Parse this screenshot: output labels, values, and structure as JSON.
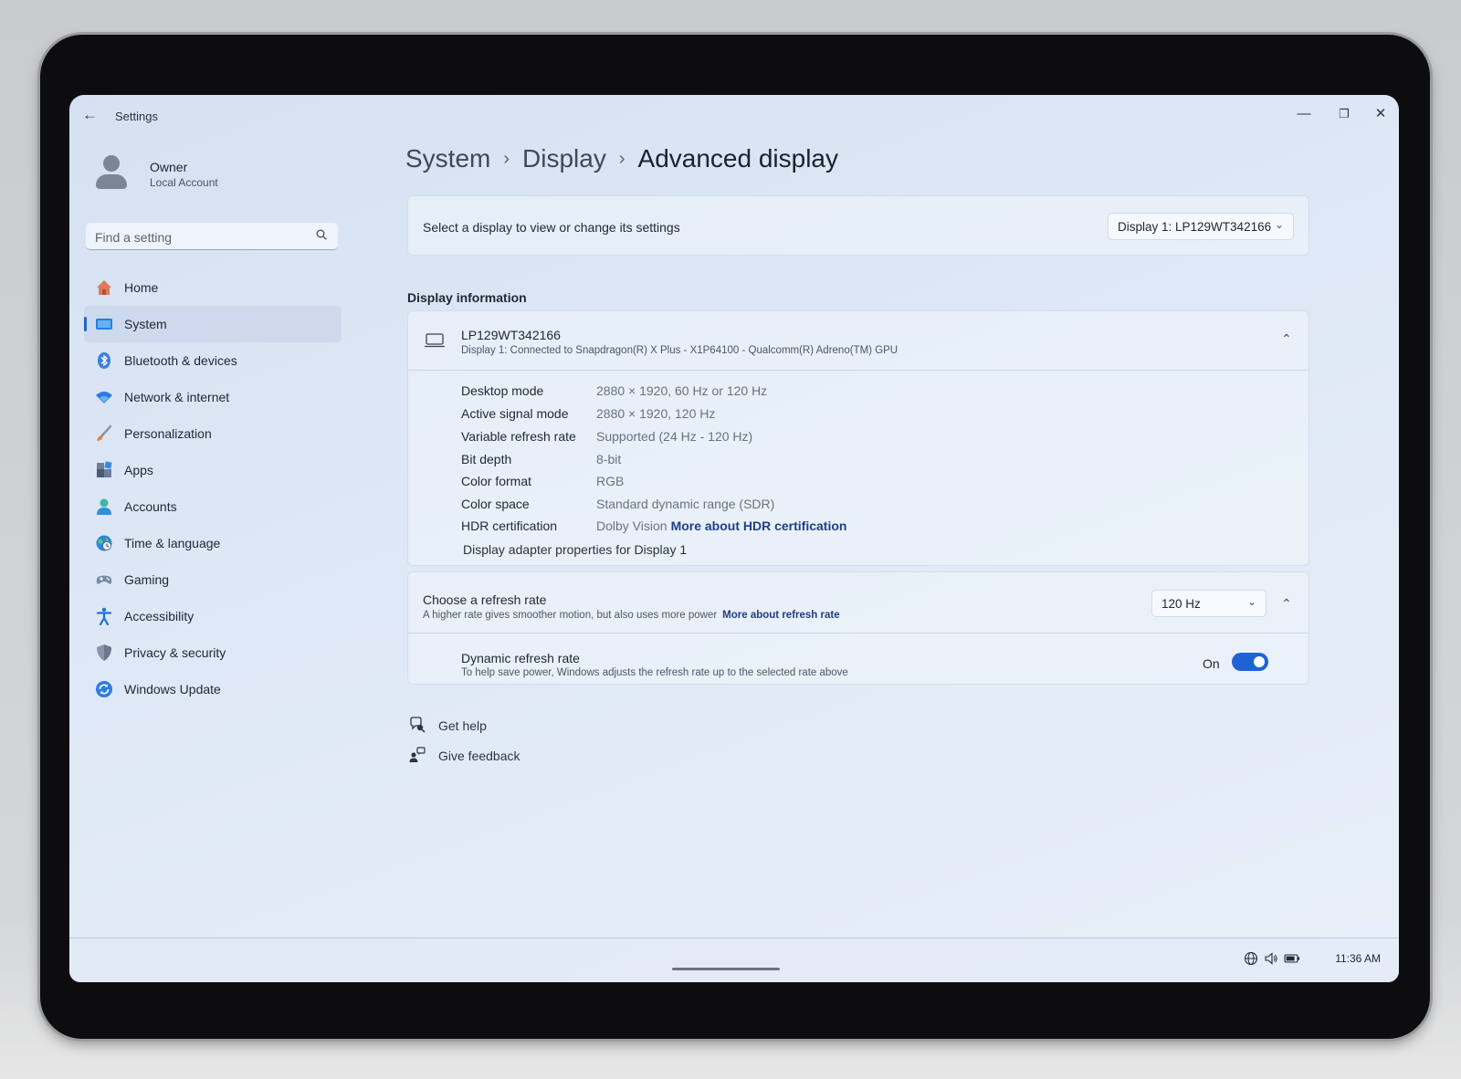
{
  "window": {
    "title": "Settings",
    "controls": {
      "minimize": "—",
      "restore": "❐",
      "close": "✕"
    }
  },
  "profile": {
    "name": "Owner",
    "account_type": "Local Account"
  },
  "search": {
    "placeholder": "Find a setting"
  },
  "sidebar": {
    "items": [
      {
        "label": "Home",
        "icon": "home-icon",
        "selected": false
      },
      {
        "label": "System",
        "icon": "system-icon",
        "selected": true
      },
      {
        "label": "Bluetooth & devices",
        "icon": "bluetooth-icon",
        "selected": false
      },
      {
        "label": "Network & internet",
        "icon": "wifi-icon",
        "selected": false
      },
      {
        "label": "Personalization",
        "icon": "brush-icon",
        "selected": false
      },
      {
        "label": "Apps",
        "icon": "apps-icon",
        "selected": false
      },
      {
        "label": "Accounts",
        "icon": "accounts-icon",
        "selected": false
      },
      {
        "label": "Time & language",
        "icon": "globe-clock-icon",
        "selected": false
      },
      {
        "label": "Gaming",
        "icon": "gamepad-icon",
        "selected": false
      },
      {
        "label": "Accessibility",
        "icon": "accessibility-icon",
        "selected": false
      },
      {
        "label": "Privacy & security",
        "icon": "shield-icon",
        "selected": false
      },
      {
        "label": "Windows Update",
        "icon": "update-icon",
        "selected": false
      }
    ]
  },
  "breadcrumb": {
    "items": [
      "System",
      "Display"
    ],
    "current": "Advanced display"
  },
  "display_select": {
    "label": "Select a display to view or change its settings",
    "value": "Display 1: LP129WT342166"
  },
  "display_info": {
    "section_title": "Display information",
    "name": "LP129WT342166",
    "description": "Display 1: Connected to Snapdragon(R) X Plus - X1P64100 - Qualcomm(R) Adreno(TM) GPU",
    "rows": [
      {
        "label": "Desktop mode",
        "value": "2880 × 1920, 60 Hz or 120 Hz"
      },
      {
        "label": "Active signal mode",
        "value": "2880 × 1920, 120 Hz"
      },
      {
        "label": "Variable refresh rate",
        "value": "Supported (24 Hz - 120 Hz)"
      },
      {
        "label": "Bit depth",
        "value": "8-bit"
      },
      {
        "label": "Color format",
        "value": "RGB"
      },
      {
        "label": "Color space",
        "value": "Standard dynamic range (SDR)"
      },
      {
        "label": "HDR certification",
        "value": "Dolby Vision",
        "link": "More about HDR certification"
      }
    ],
    "adapter_link": "Display adapter properties for Display 1"
  },
  "refresh_rate": {
    "title": "Choose a refresh rate",
    "description": "A higher rate gives smoother motion, but also uses more power",
    "link": "More about refresh rate",
    "value": "120 Hz",
    "dynamic": {
      "title": "Dynamic refresh rate",
      "description": "To help save power, Windows adjusts the refresh rate up to the selected rate above",
      "state": "On"
    }
  },
  "help": {
    "get_help": "Get help",
    "give_feedback": "Give feedback"
  },
  "taskbar": {
    "time": "11:36 AM"
  },
  "colors": {
    "accent": "#1e62d6",
    "link": "#1e3f86"
  }
}
